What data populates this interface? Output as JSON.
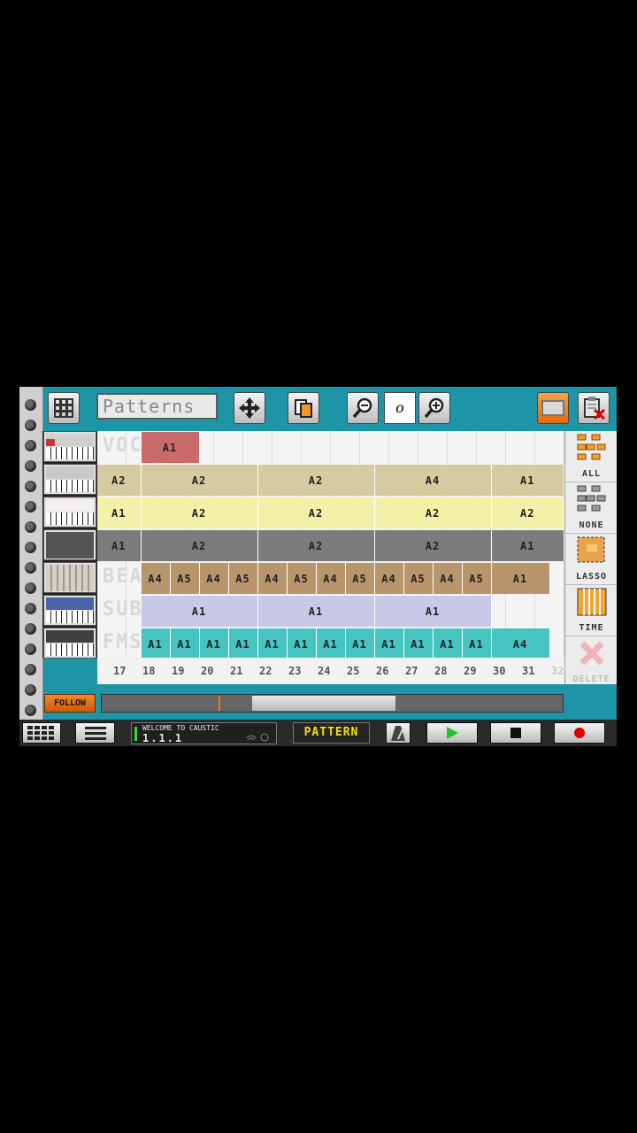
{
  "toolbar": {
    "title": "Patterns",
    "zoom_value": "o"
  },
  "tracks": [
    {
      "name": "VOCODER",
      "color": "#f2f2f2"
    },
    {
      "name": "",
      "color": "#d6caa0"
    },
    {
      "name": "",
      "color": "#f3f0a8"
    },
    {
      "name": "",
      "color": "#7c7c7c"
    },
    {
      "name": "BEATBOX",
      "color": "#b9956b"
    },
    {
      "name": "SUBSYNTH",
      "color": "#c7c9e6"
    },
    {
      "name": "FMSYNTH",
      "color": "#45c4c0"
    }
  ],
  "patterns": [
    [
      {
        "label": "A1",
        "start": 18,
        "len": 2,
        "color": "#c96b6b"
      }
    ],
    [
      {
        "label": "A2",
        "start": 16.5,
        "len": 1.5
      },
      {
        "label": "A2",
        "start": 18,
        "len": 4
      },
      {
        "label": "A2",
        "start": 22,
        "len": 4
      },
      {
        "label": "A4",
        "start": 26,
        "len": 4
      },
      {
        "label": "A1",
        "start": 30,
        "len": 2.5
      }
    ],
    [
      {
        "label": "A1",
        "start": 16.5,
        "len": 1.5
      },
      {
        "label": "A2",
        "start": 18,
        "len": 4
      },
      {
        "label": "A2",
        "start": 22,
        "len": 4
      },
      {
        "label": "A2",
        "start": 26,
        "len": 4
      },
      {
        "label": "A2",
        "start": 30,
        "len": 2.5
      }
    ],
    [
      {
        "label": "A1",
        "start": 16.5,
        "len": 1.5
      },
      {
        "label": "A2",
        "start": 18,
        "len": 4
      },
      {
        "label": "A2",
        "start": 22,
        "len": 4
      },
      {
        "label": "A2",
        "start": 26,
        "len": 4
      },
      {
        "label": "A1",
        "start": 30,
        "len": 2.5
      }
    ],
    [
      {
        "label": "A4",
        "start": 18,
        "len": 1
      },
      {
        "label": "A5",
        "start": 19,
        "len": 1
      },
      {
        "label": "A4",
        "start": 20,
        "len": 1
      },
      {
        "label": "A5",
        "start": 21,
        "len": 1
      },
      {
        "label": "A4",
        "start": 22,
        "len": 1
      },
      {
        "label": "A5",
        "start": 23,
        "len": 1
      },
      {
        "label": "A4",
        "start": 24,
        "len": 1
      },
      {
        "label": "A5",
        "start": 25,
        "len": 1
      },
      {
        "label": "A4",
        "start": 26,
        "len": 1
      },
      {
        "label": "A5",
        "start": 27,
        "len": 1
      },
      {
        "label": "A4",
        "start": 28,
        "len": 1
      },
      {
        "label": "A5",
        "start": 29,
        "len": 1
      },
      {
        "label": "A1",
        "start": 30,
        "len": 2
      }
    ],
    [
      {
        "label": "A1",
        "start": 18,
        "len": 4
      },
      {
        "label": "A1",
        "start": 22,
        "len": 4
      },
      {
        "label": "A1",
        "start": 26,
        "len": 4
      }
    ],
    [
      {
        "label": "A1",
        "start": 18,
        "len": 1
      },
      {
        "label": "A1",
        "start": 19,
        "len": 1
      },
      {
        "label": "A1",
        "start": 20,
        "len": 1
      },
      {
        "label": "A1",
        "start": 21,
        "len": 1
      },
      {
        "label": "A1",
        "start": 22,
        "len": 1
      },
      {
        "label": "A1",
        "start": 23,
        "len": 1
      },
      {
        "label": "A1",
        "start": 24,
        "len": 1
      },
      {
        "label": "A1",
        "start": 25,
        "len": 1
      },
      {
        "label": "A1",
        "start": 26,
        "len": 1
      },
      {
        "label": "A1",
        "start": 27,
        "len": 1
      },
      {
        "label": "A1",
        "start": 28,
        "len": 1
      },
      {
        "label": "A1",
        "start": 29,
        "len": 1
      },
      {
        "label": "A4",
        "start": 30,
        "len": 2
      }
    ]
  ],
  "ruler": [
    "17",
    "18",
    "19",
    "20",
    "21",
    "22",
    "23",
    "24",
    "25",
    "26",
    "27",
    "28",
    "29",
    "30",
    "31",
    "32"
  ],
  "tools": {
    "all": "ALL",
    "none": "NONE",
    "lasso": "LASSO",
    "time": "TIME",
    "delete": "DELETE"
  },
  "follow_label": "FOLLOW",
  "lcd": {
    "message": "WELCOME TO CAUSTIC",
    "position": "1.1.1"
  },
  "mode_label": "PATTERN",
  "colors": {
    "accent": "#1d95a6",
    "follow": "#e0741b",
    "play": "#22c22a",
    "record": "#e00000",
    "mode_text": "#f3e000"
  }
}
